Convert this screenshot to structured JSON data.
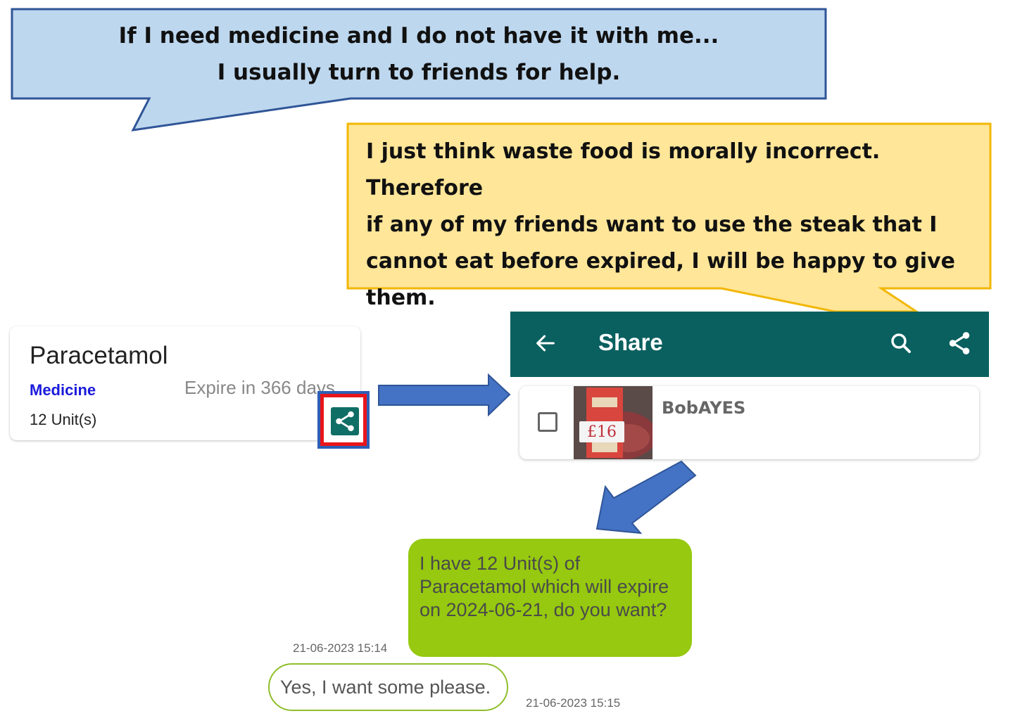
{
  "callouts": {
    "blue": {
      "line1": "If I need medicine and I do not have it with me...",
      "line2": "I usually turn to friends for help."
    },
    "yellow": {
      "line1": "I just think waste food is morally incorrect. Therefore",
      "line2": "if any of my friends want to use the steak that I",
      "line3": "cannot eat before expired, I will be happy to give",
      "line4": "them."
    }
  },
  "item_card": {
    "name": "Paracetamol",
    "category": "Medicine",
    "quantity": "12  Unit(s)",
    "expiry": "Expire in 366 days",
    "share_button_icon": "share-icon"
  },
  "share_screen": {
    "title": "Share",
    "back_icon": "arrow-left-icon",
    "search_icon": "search-icon",
    "share_icon": "share-icon",
    "contact": {
      "name": "BobAYES",
      "price_tag": "£16",
      "checked": false
    }
  },
  "chat": {
    "outgoing": {
      "text": "I have 12 Unit(s) of Paracetamol which will expire on 2024-06-21, do you want?",
      "time": "21-06-2023 15:14"
    },
    "reply": {
      "text": "Yes, I want some please.",
      "time": "21-06-2023 15:15"
    }
  },
  "colors": {
    "blue_callout": "#bdd7ee",
    "yellow_callout": "#ffe699",
    "app_teal": "#09605f",
    "chat_green": "#96c90f",
    "arrow_blue": "#4472c4",
    "highlight_red": "#e8161b",
    "category_blue": "#1a1adb"
  }
}
